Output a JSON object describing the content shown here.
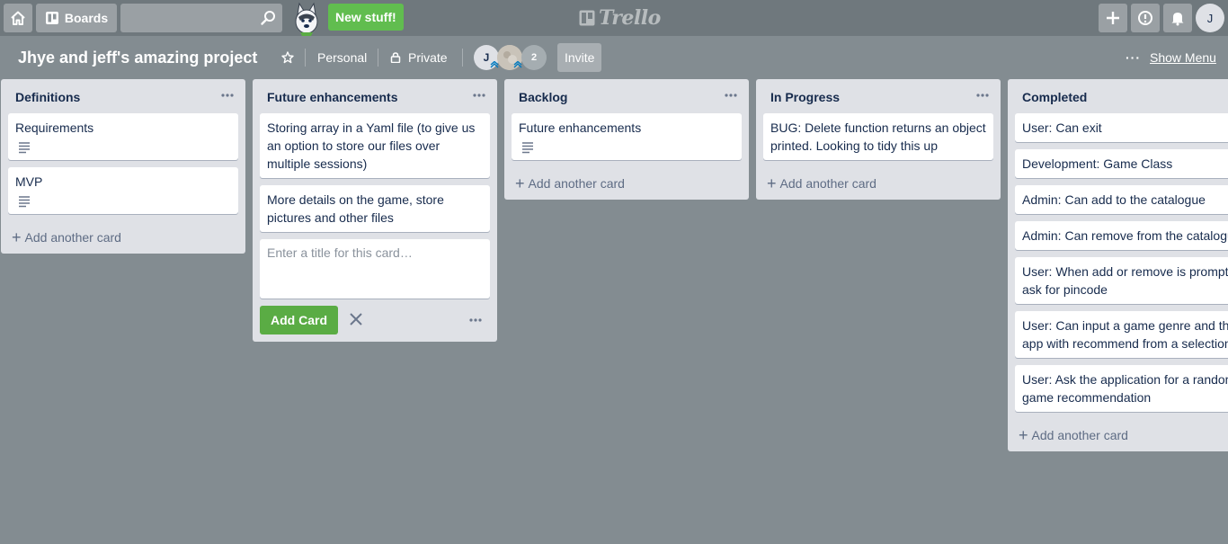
{
  "header": {
    "boards_label": "Boards",
    "search_placeholder": "",
    "new_stuff_label": "New stuff!",
    "logo_text": "Trello",
    "avatar_initial": "J"
  },
  "board": {
    "title": "Jhye and jeff's amazing project",
    "team_label": "Personal",
    "visibility_label": "Private",
    "members": {
      "first_initial": "J",
      "more_count": "2"
    },
    "invite_label": "Invite",
    "show_menu_label": "Show Menu"
  },
  "lists": [
    {
      "title": "Definitions",
      "cards": [
        {
          "title": "Requirements",
          "has_description": true
        },
        {
          "title": "MVP",
          "has_description": true
        }
      ],
      "add_card_label": "Add another card"
    },
    {
      "title": "Future enhancements",
      "cards": [
        {
          "title": "Storing array in a Yaml file (to give us an option to store our files over multiple sessions)"
        },
        {
          "title": "More details on the game, store pictures and other files"
        }
      ],
      "composer": {
        "placeholder": "Enter a title for this card…",
        "add_button_label": "Add Card"
      }
    },
    {
      "title": "Backlog",
      "cards": [
        {
          "title": "Future enhancements",
          "has_description": true
        }
      ],
      "add_card_label": "Add another card"
    },
    {
      "title": "In Progress",
      "cards": [
        {
          "title": "BUG: Delete function returns an object printed. Looking to tidy this up"
        }
      ],
      "add_card_label": "Add another card"
    },
    {
      "title": "Completed",
      "cards": [
        {
          "title": "User: Can exit"
        },
        {
          "title": "Development: Game Class"
        },
        {
          "title": "Admin: Can add to the catalogue"
        },
        {
          "title": "Admin: Can remove from the catalogue"
        },
        {
          "title": "User: When add or remove is prompted, ask for pincode"
        },
        {
          "title": "User: Can input a game genre and the app with recommend from a selection"
        },
        {
          "title": "User: Ask the application for a random game recommendation"
        }
      ],
      "add_card_label": "Add another card"
    }
  ],
  "colors": {
    "background": "#838c91",
    "header": "#6f787d",
    "list": "#dfe1e6",
    "accent_green": "#5aac44"
  }
}
